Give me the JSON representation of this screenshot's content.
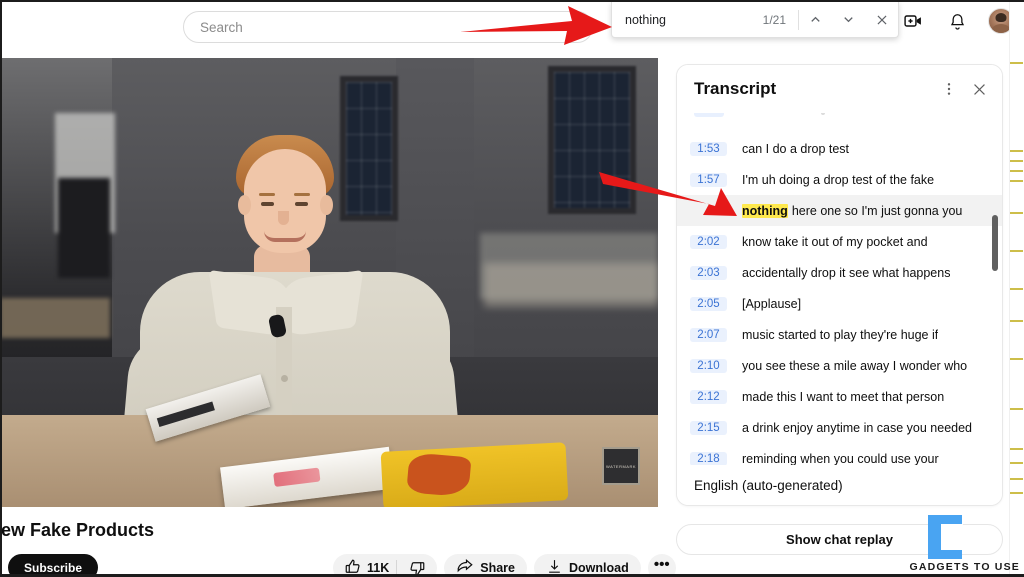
{
  "browser": {
    "search": {
      "placeholder": "Search",
      "value": ""
    },
    "find_in_page": {
      "query": "nothing",
      "match_counter": "1/21",
      "previous_label": "Previous match",
      "next_label": "Next match",
      "close_label": "Close find bar"
    },
    "top_icons": {
      "create": "create-video-icon",
      "notifications": "notifications-bell-icon",
      "account": "account-avatar"
    }
  },
  "player": {
    "channel_watermark": "WATERMARK"
  },
  "video_meta": {
    "title": "iew Fake Products",
    "subscribe_label": "Subscribe",
    "like_count": "11K",
    "share_label": "Share",
    "download_label": "Download",
    "more_label": "•••"
  },
  "transcript": {
    "title": "Transcript",
    "menu_label": "More options",
    "close_label": "Close transcript",
    "language": "English (auto-generated)",
    "highlight_term": "nothing",
    "lines": [
      {
        "time": "1:53",
        "text": "can I do a drop test",
        "highlighted": false
      },
      {
        "time": "1:57",
        "text": "I'm uh doing a drop test of the fake",
        "highlighted": false
      },
      {
        "time": "",
        "text": "here one so I'm just gonna you",
        "highlighted": true
      },
      {
        "time": "2:02",
        "text": "know take it out of my pocket and",
        "highlighted": false
      },
      {
        "time": "2:03",
        "text": "accidentally drop it see what happens",
        "highlighted": false
      },
      {
        "time": "2:05",
        "text": "[Applause]",
        "highlighted": false
      },
      {
        "time": "2:07",
        "text": "music started to play they're huge if",
        "highlighted": false
      },
      {
        "time": "2:10",
        "text": "you see these a mile away I wonder who",
        "highlighted": false
      },
      {
        "time": "2:12",
        "text": "made this I want to meet that person",
        "highlighted": false
      },
      {
        "time": "2:15",
        "text": "a drink enjoy anytime in case you needed",
        "highlighted": false
      },
      {
        "time": "2:18",
        "text": "reminding when you could use your",
        "highlighted": false
      }
    ]
  },
  "chat": {
    "show_chat_replay_label": "Show chat replay"
  },
  "watermark": {
    "text": "GADGETS TO USE"
  },
  "colors": {
    "accent_blue": "#3b73d4",
    "timestamp_chip": "#eaf1fd",
    "find_highlight": "#ffe94d",
    "annotation_red": "#e61919",
    "active_row": "#f2f2f2",
    "scrollbar_tick": "#cdbe4a",
    "logo_blue": "#49a4f2"
  },
  "scrollbar_ticks": [
    62,
    150,
    160,
    170,
    180,
    212,
    250,
    288,
    320,
    358,
    408,
    448,
    462,
    478,
    492
  ]
}
